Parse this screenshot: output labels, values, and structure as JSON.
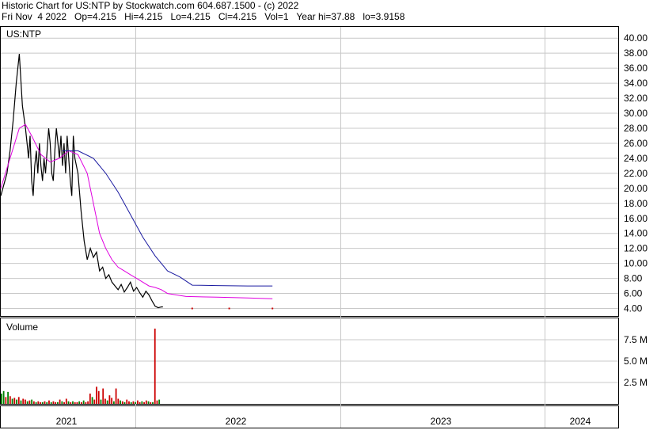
{
  "header": {
    "line1": "Historic Chart for US:NTP by Stockwatch.com 604.687.1500 - (c) 2022",
    "line2": "Fri Nov  4 2022   Op=4.215   Hi=4.215   Lo=4.215   Cl=4.215   Vol=1   Year hi=37.88   lo=3.9158"
  },
  "colors": {
    "price": "#000000",
    "ma_short": "#e000e0",
    "ma_long": "#1a1aa0",
    "vol_up": "#008000",
    "vol_down": "#cc0000",
    "grid": "#c8c8c8"
  },
  "chart_data": [
    {
      "type": "line",
      "title": "US:NTP",
      "ylim": [
        3.0,
        41.5
      ],
      "yticks": [
        "40.00",
        "38.00",
        "36.00",
        "34.00",
        "32.00",
        "30.00",
        "28.00",
        "26.00",
        "24.00",
        "22.00",
        "20.00",
        "18.00",
        "16.00",
        "14.00",
        "12.00",
        "10.00",
        "8.00",
        "6.00",
        "4.00"
      ],
      "x_years": [
        "2021",
        "2022",
        "2023",
        "2024"
      ],
      "series": [
        {
          "role": "price",
          "x": [
            0.0,
            0.02,
            0.03,
            0.04,
            0.05,
            0.06,
            0.07,
            0.08,
            0.085,
            0.09,
            0.095,
            0.1,
            0.105,
            0.11,
            0.115,
            0.12,
            0.125,
            0.13,
            0.135,
            0.14,
            0.145,
            0.15,
            0.155,
            0.16,
            0.165,
            0.17,
            0.175,
            0.18,
            0.185,
            0.19,
            0.195,
            0.2,
            0.205,
            0.21,
            0.215,
            0.22,
            0.225,
            0.23,
            0.235,
            0.24,
            0.25,
            0.26,
            0.27,
            0.28,
            0.29,
            0.3,
            0.31,
            0.32,
            0.33,
            0.34,
            0.35,
            0.36,
            0.37,
            0.38,
            0.39,
            0.4,
            0.41,
            0.42,
            0.43,
            0.44,
            0.45,
            0.46,
            0.47,
            0.48,
            0.49,
            0.5,
            0.51,
            0.52,
            0.525
          ],
          "y": [
            19,
            22,
            25,
            29,
            34,
            37.9,
            31,
            28,
            26,
            24,
            27,
            21,
            19,
            23,
            25,
            22,
            26,
            23,
            21,
            24,
            22,
            25,
            28,
            26,
            22,
            21,
            25,
            28,
            26,
            24,
            27,
            23,
            26,
            22,
            27,
            24,
            21,
            19,
            27,
            24,
            22,
            17,
            13,
            10.5,
            12,
            10.8,
            11.5,
            9,
            9.5,
            8,
            8.5,
            7.5,
            7,
            6.5,
            7.2,
            6.2,
            6.8,
            7.5,
            6.3,
            6.8,
            6.1,
            5.5,
            6.3,
            5.8,
            5.0,
            4.3,
            4.1,
            4.2,
            4.215
          ]
        },
        {
          "role": "ma_short",
          "x": [
            0.0,
            0.03,
            0.06,
            0.08,
            0.1,
            0.13,
            0.16,
            0.19,
            0.22,
            0.25,
            0.28,
            0.3,
            0.32,
            0.34,
            0.36,
            0.38,
            0.4,
            0.42,
            0.44,
            0.46,
            0.48,
            0.5,
            0.52,
            0.54,
            0.6,
            0.7,
            0.8,
            0.88
          ],
          "y": [
            20,
            24,
            28,
            28.5,
            27,
            24.5,
            23.5,
            24,
            25,
            24.5,
            22,
            18,
            14,
            12,
            10.5,
            9.5,
            9,
            8.5,
            8,
            7.5,
            7,
            6.8,
            6.5,
            6,
            5.6,
            5.5,
            5.4,
            5.3
          ]
        },
        {
          "role": "ma_long",
          "x": [
            0.2,
            0.25,
            0.3,
            0.34,
            0.38,
            0.42,
            0.46,
            0.5,
            0.54,
            0.58,
            0.62,
            0.7,
            0.8,
            0.88
          ],
          "y": [
            25,
            25,
            24,
            22,
            19.5,
            16.5,
            13.5,
            11,
            9,
            8.2,
            7.1,
            7.05,
            7.0,
            7.0
          ]
        },
        {
          "role": "markers",
          "x": [
            0.62,
            0.74,
            0.88
          ],
          "y": [
            4.0,
            4.0,
            4.0
          ]
        }
      ]
    },
    {
      "type": "bar",
      "title": "Volume",
      "ylim": [
        0,
        10
      ],
      "yticks": [
        "7.5 M",
        "5.0 M",
        "2.5 M"
      ],
      "x": [
        0.0,
        0.007,
        0.014,
        0.021,
        0.028,
        0.035,
        0.042,
        0.049,
        0.056,
        0.063,
        0.07,
        0.077,
        0.084,
        0.091,
        0.098,
        0.105,
        0.112,
        0.119,
        0.126,
        0.133,
        0.14,
        0.147,
        0.154,
        0.161,
        0.168,
        0.175,
        0.182,
        0.189,
        0.196,
        0.203,
        0.21,
        0.217,
        0.224,
        0.231,
        0.238,
        0.245,
        0.252,
        0.259,
        0.266,
        0.273,
        0.28,
        0.287,
        0.294,
        0.301,
        0.308,
        0.315,
        0.322,
        0.329,
        0.336,
        0.343,
        0.35,
        0.357,
        0.364,
        0.371,
        0.378,
        0.385,
        0.392,
        0.399,
        0.406,
        0.413,
        0.42,
        0.427,
        0.434,
        0.441,
        0.448,
        0.455,
        0.462,
        0.469,
        0.476,
        0.483,
        0.49,
        0.497,
        0.504,
        0.511
      ],
      "values": [
        1.2,
        1.5,
        0.8,
        1.4,
        0.9,
        0.6,
        0.7,
        0.5,
        0.8,
        0.4,
        0.6,
        0.5,
        0.3,
        0.4,
        0.5,
        0.3,
        0.2,
        0.3,
        0.2,
        0.2,
        0.3,
        0.2,
        0.4,
        0.2,
        0.3,
        0.2,
        0.2,
        0.5,
        0.3,
        0.2,
        0.6,
        0.3,
        0.2,
        0.3,
        0.2,
        0.2,
        0.3,
        0.2,
        0.4,
        0.2,
        0.3,
        1.2,
        0.8,
        0.5,
        2.0,
        1.5,
        0.5,
        1.8,
        0.6,
        0.4,
        1.0,
        0.7,
        0.3,
        1.8,
        0.6,
        0.4,
        0.3,
        0.2,
        0.5,
        0.3,
        0.2,
        0.3,
        0.2,
        0.4,
        0.2,
        0.3,
        0.2,
        0.4,
        0.3,
        0.2,
        0.2,
        8.8,
        0.4,
        0.5
      ],
      "colors_up": [
        1,
        1,
        0,
        1,
        0,
        1,
        0,
        1,
        0,
        1,
        0,
        0,
        1,
        0,
        1,
        0,
        1,
        0,
        0,
        1,
        0,
        1,
        0,
        1,
        0,
        0,
        1,
        0,
        1,
        0,
        0,
        1,
        0,
        1,
        0,
        0,
        1,
        0,
        1,
        0,
        0,
        0,
        1,
        0,
        0,
        0,
        1,
        0,
        0,
        1,
        0,
        0,
        1,
        0,
        0,
        1,
        0,
        1,
        0,
        0,
        1,
        0,
        1,
        0,
        0,
        1,
        0,
        0,
        1,
        0,
        1,
        0,
        0,
        1
      ]
    }
  ]
}
